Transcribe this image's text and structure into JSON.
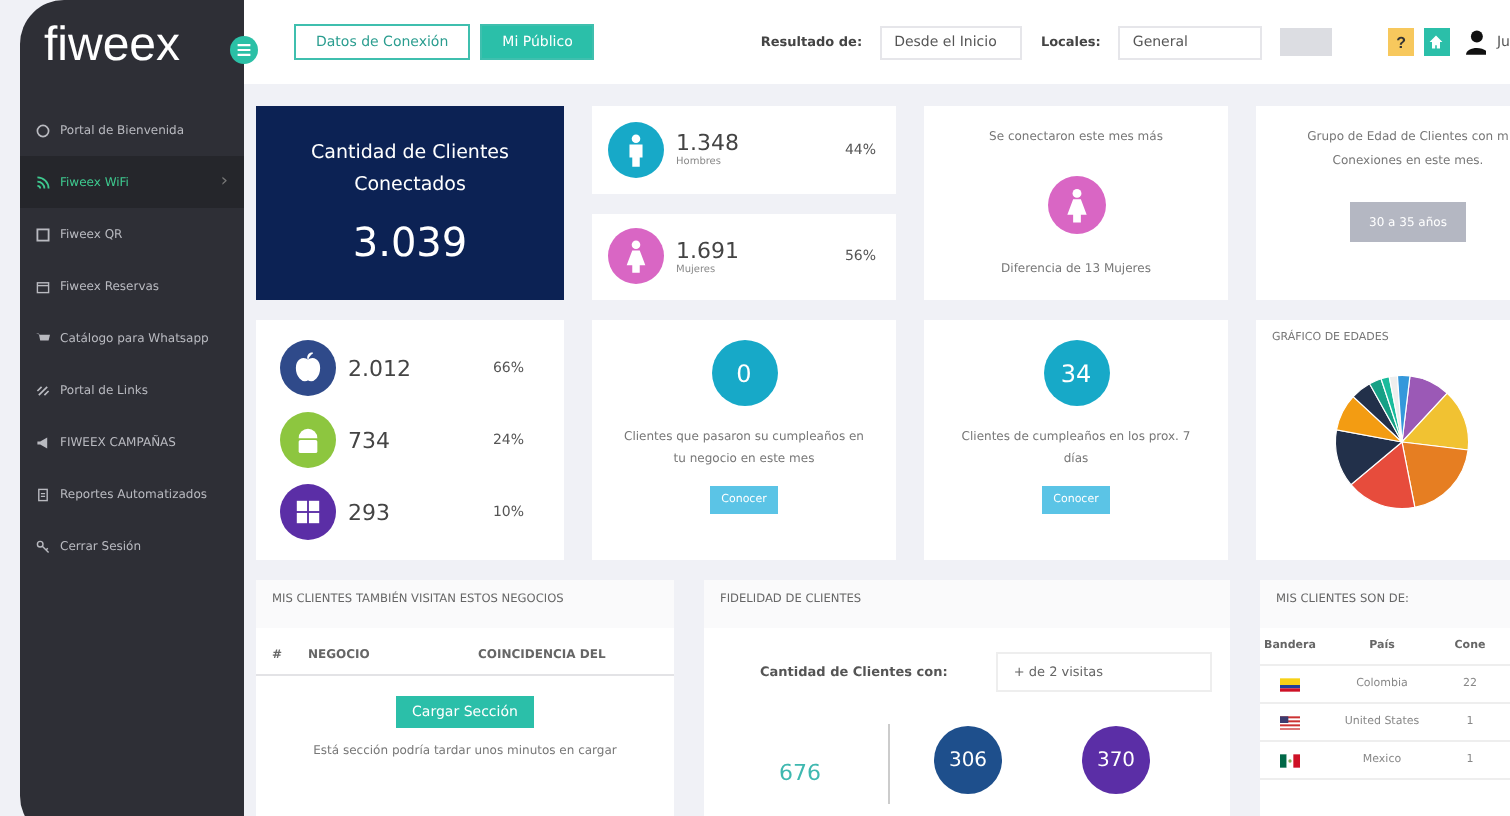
{
  "sidebar": {
    "logo": "fiweex",
    "items": [
      {
        "label": "Portal de Bienvenida",
        "selected": false
      },
      {
        "label": "Fiweex WiFi",
        "selected": true,
        "chevron": "›"
      },
      {
        "label": "Fiweex QR",
        "selected": false
      },
      {
        "label": "Fiweex Reservas",
        "selected": false
      },
      {
        "label": "Catálogo para Whatsapp",
        "selected": false
      },
      {
        "label": "Portal de Links",
        "selected": false
      },
      {
        "label": "FIWEEX CAMPAÑAS",
        "selected": false
      },
      {
        "label": "Reportes Automatizados",
        "selected": false
      },
      {
        "label": "Cerrar Sesión",
        "selected": false
      }
    ]
  },
  "header": {
    "tabs": [
      {
        "label": "Datos de Conexión",
        "selected": false
      },
      {
        "label": "Mi Público",
        "selected": true
      }
    ],
    "result_label": "Resultado de:",
    "result_value": "Desde el Inicio",
    "locales_label": "Locales:",
    "locales_value": "General",
    "apply_disabled": true,
    "help": "?",
    "user_name": "Ju"
  },
  "total_card": {
    "title": "Cantidad de Clientes Conectados",
    "value": "3.039"
  },
  "gender": [
    {
      "kind": "male",
      "value": "1.348",
      "label": "Hombres",
      "percent": "44%",
      "color": "#17a9c8"
    },
    {
      "kind": "female",
      "value": "1.691",
      "label": "Mujeres",
      "percent": "56%",
      "color": "#d966c4"
    }
  ],
  "month_card": {
    "title": "Se conectaron este mes más",
    "kind": "female",
    "color": "#d966c4",
    "caption": "Diferencia de 13 Mujeres"
  },
  "age_group_card": {
    "title": "Grupo de Edad de Clientes con m Conexiones en este mes.",
    "button": "30 a 35 años"
  },
  "os": [
    {
      "kind": "apple",
      "value": "2.012",
      "percent": "66%",
      "color": "#2f4a8a"
    },
    {
      "kind": "android",
      "value": "734",
      "percent": "24%",
      "color": "#8dc63f"
    },
    {
      "kind": "windows",
      "value": "293",
      "percent": "10%",
      "color": "#5b2ea6"
    }
  ],
  "birthdays": [
    {
      "value": "0",
      "text": "Clientes que pasaron su cumpleaños en tu negocio en este mes",
      "button": "Conocer"
    },
    {
      "value": "34",
      "text": "Clientes de cumpleaños en los prox. 7 días",
      "button": "Conocer"
    }
  ],
  "age_chart": {
    "title": "GRÁFICO DE EDADES"
  },
  "other_business": {
    "title": "MIS CLIENTES TAMBIÉN VISITAN ESTOS NEGOCIOS",
    "columns": [
      "#",
      "NEGOCIO",
      "COINCIDENCIA DEL"
    ],
    "button": "Cargar Sección",
    "note": "Está sección podría tardar unos minutos en cargar"
  },
  "fidelity": {
    "title": "FIDELIDAD DE CLIENTES",
    "label": "Cantidad de Clientes con:",
    "value": "+ de 2 visitas",
    "numbers": [
      {
        "kind": "plain",
        "value": "676",
        "color": "#3fb8b0"
      },
      {
        "kind": "circle",
        "value": "306",
        "color": "#1e4f8c"
      },
      {
        "kind": "circle",
        "value": "370",
        "color": "#5b2ea6"
      }
    ]
  },
  "countries": {
    "title": "MIS CLIENTES SON DE:",
    "columns": [
      "Bandera",
      "País",
      "Cone"
    ],
    "rows": [
      {
        "country": "Colombia",
        "connections": "22"
      },
      {
        "country": "United States",
        "connections": "1"
      },
      {
        "country": "Mexico",
        "connections": "1"
      }
    ]
  }
}
